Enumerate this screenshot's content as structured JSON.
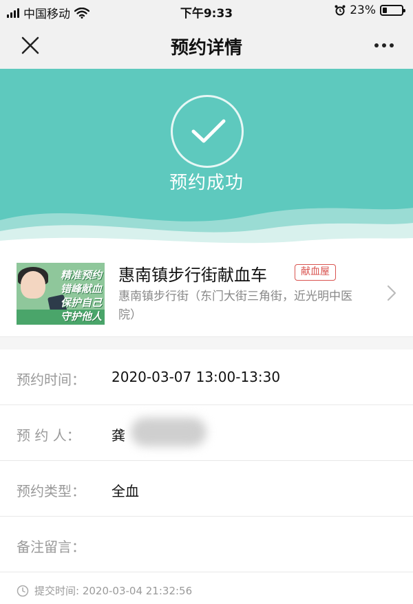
{
  "status_bar": {
    "carrier": "中国移动",
    "time": "下午9:33",
    "battery_percent": "23%",
    "battery_level": 0.23,
    "icons": [
      "signal-icon",
      "wifi-icon",
      "alarm-icon",
      "battery-icon"
    ]
  },
  "nav": {
    "title": "预约详情",
    "left_icon": "close-icon",
    "right_icon": "more-icon"
  },
  "hero": {
    "status_text": "预约成功",
    "icon": "check-icon",
    "color": "#5ec9be"
  },
  "venue": {
    "name": "惠南镇步行街献血车",
    "tag": "献血屋",
    "address": "惠南镇步行街（东门大街三角街，近光明中医院）",
    "thumbnail_text": [
      "精准预约",
      "错峰献血",
      "保护自己",
      "守护他人"
    ],
    "tag_color": "#d9534f"
  },
  "details": [
    {
      "label": "预约时间：",
      "value": "2020-03-07 13:00-13:30"
    },
    {
      "label": "预 约 人：",
      "value": "龚"
    },
    {
      "label": "预约类型：",
      "value": "全血"
    },
    {
      "label": "备注留言：",
      "value": ""
    }
  ],
  "submit": {
    "text": "提交时间: 2020-03-04 21:32:56",
    "icon": "clock-icon"
  }
}
